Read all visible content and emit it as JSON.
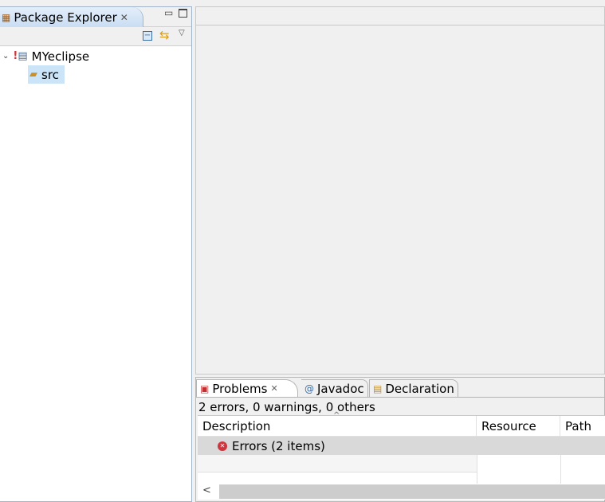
{
  "package_explorer": {
    "title": "Package Explorer",
    "tree": [
      {
        "label": "MYeclipse"
      },
      {
        "label": "src"
      }
    ]
  },
  "bottom_panel": {
    "tabs": [
      {
        "label": "Problems"
      },
      {
        "label": "Javadoc"
      },
      {
        "label": "Declaration"
      }
    ],
    "summary": "2 errors, 0 warnings, 0 others",
    "columns": [
      "Description",
      "Resource",
      "Path"
    ],
    "rows": [
      {
        "description": "Errors (2 items)"
      }
    ]
  },
  "colors": {
    "error": "#d0343c",
    "selection": "#cce4f7"
  }
}
